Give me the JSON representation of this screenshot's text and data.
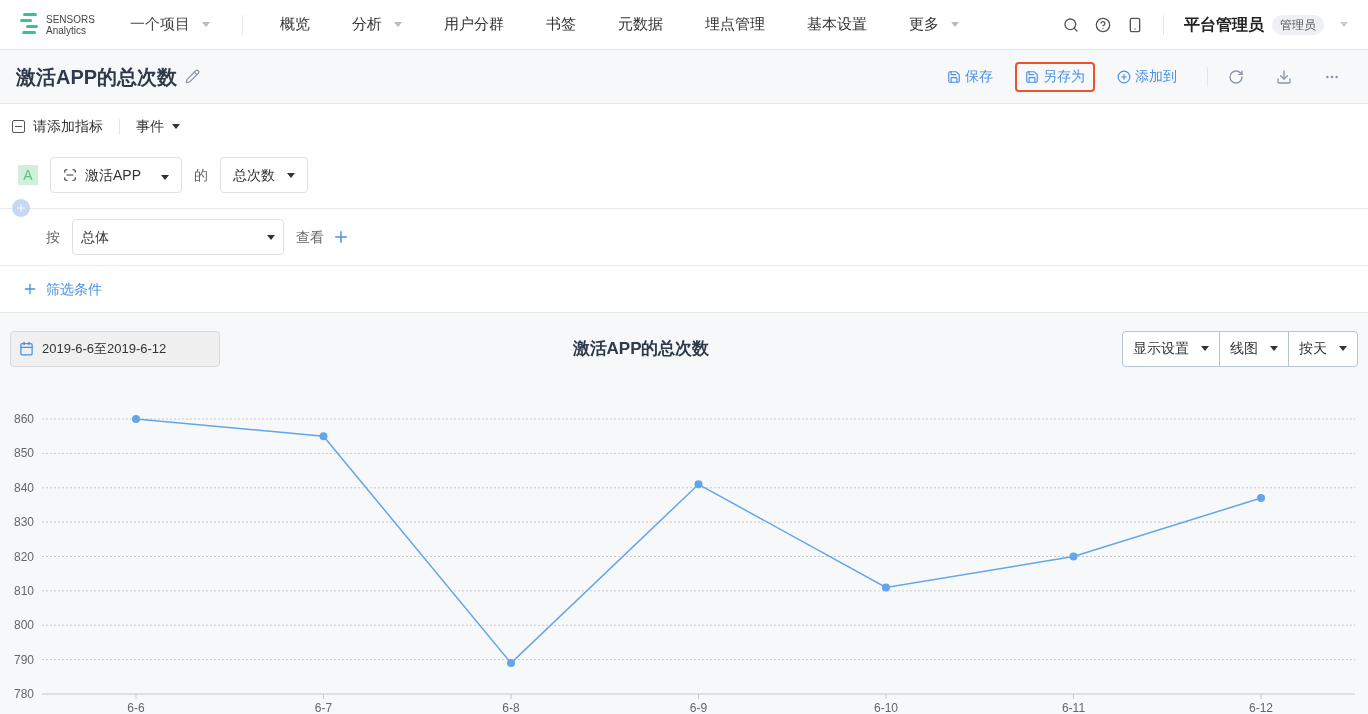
{
  "logo": {
    "line1": "SENSORS",
    "line2": "Analytics"
  },
  "project": {
    "label": "一个项目"
  },
  "nav": [
    {
      "label": "概览",
      "dropdown": false
    },
    {
      "label": "分析",
      "dropdown": true
    },
    {
      "label": "用户分群",
      "dropdown": false
    },
    {
      "label": "书签",
      "dropdown": false
    },
    {
      "label": "元数据",
      "dropdown": false
    },
    {
      "label": "埋点管理",
      "dropdown": false
    },
    {
      "label": "基本设置",
      "dropdown": false
    },
    {
      "label": "更多",
      "dropdown": true
    }
  ],
  "user": {
    "name": "平台管理员",
    "role": "管理员"
  },
  "report": {
    "title": "激活APP的总次数"
  },
  "actions": [
    {
      "kind": "save",
      "label": "保存",
      "highlighted": false
    },
    {
      "kind": "save-as",
      "label": "另存为",
      "highlighted": true
    },
    {
      "kind": "add",
      "label": "添加到",
      "highlighted": false
    }
  ],
  "metric": {
    "header": "请添加指标",
    "type": "事件",
    "letter": "A",
    "event": "激活APP",
    "of": "的",
    "measure": "总次数"
  },
  "group": {
    "by": "按",
    "value": "总体",
    "view": "查看"
  },
  "filter": {
    "label": "筛选条件"
  },
  "date_range": "2019-6-6至2019-6-12",
  "view_controls": [
    {
      "label": "显示设置"
    },
    {
      "label": "线图"
    },
    {
      "label": "按天"
    }
  ],
  "chart": {
    "chart_data": {
      "type": "line",
      "title": "激活APP的总次数",
      "categories": [
        "6-6",
        "6-7",
        "6-8",
        "6-9",
        "6-10",
        "6-11",
        "6-12"
      ],
      "grid": true,
      "series": [
        {
          "color": "#63a5e8",
          "marker": true,
          "values": [
            860,
            855,
            789,
            841,
            811,
            820,
            837
          ]
        }
      ],
      "ylim": [
        780,
        860
      ],
      "yticks": [
        780,
        790,
        800,
        810,
        820,
        830,
        840,
        850,
        860
      ]
    }
  }
}
